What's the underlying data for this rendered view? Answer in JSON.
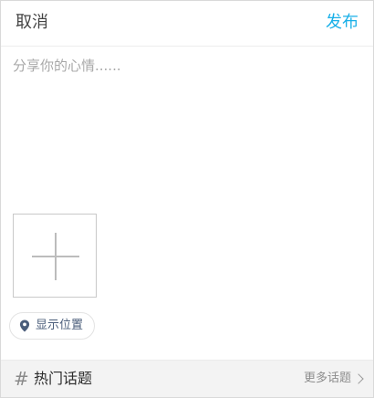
{
  "header": {
    "cancel_label": "取消",
    "publish_label": "发布"
  },
  "compose": {
    "placeholder": "分享你的心情......",
    "value": ""
  },
  "media": {
    "add_icon": "plus-icon"
  },
  "location": {
    "icon": "map-pin-icon",
    "label": "显示位置"
  },
  "topics": {
    "hash_symbol": "#",
    "title": "热门话题",
    "more_label": "更多话题",
    "more_icon": "chevron-right-icon"
  },
  "colors": {
    "accent": "#1ab0e8",
    "location_text": "#4a5d7a",
    "topics_bar_bg": "#f3f3f3"
  }
}
